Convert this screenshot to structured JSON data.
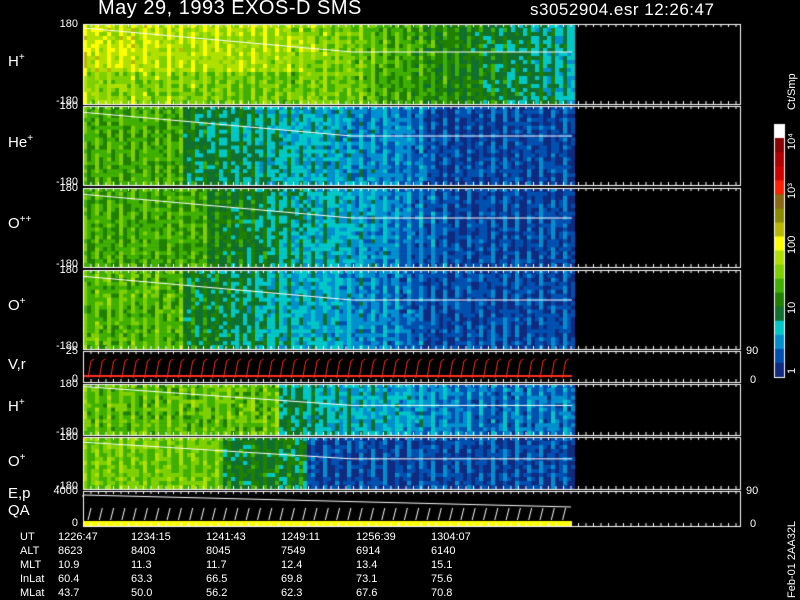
{
  "header": {
    "title": "May 29, 1993   EXOS-D SMS",
    "file_time": "s3052904.esr  12:26:47"
  },
  "panels": [
    {
      "id": "h-plus",
      "label": "H",
      "sup": "+",
      "ytop": "180",
      "ybot": "-180"
    },
    {
      "id": "he-plus",
      "label": "He",
      "sup": "+",
      "ytop": "180",
      "ybot": "-180"
    },
    {
      "id": "o-pp",
      "label": "O",
      "sup": "++",
      "ytop": "180",
      "ybot": "-180"
    },
    {
      "id": "o-plus",
      "label": "O",
      "sup": "+",
      "ytop": "180",
      "ybot": "-180"
    },
    {
      "id": "vr",
      "label": "V,r",
      "sup": "",
      "ytop": "25",
      "ybot": "0",
      "rtop": "90",
      "rbot": "0"
    },
    {
      "id": "h-plus-2",
      "label": "H",
      "sup": "+",
      "ytop": "180",
      "ybot": "-180"
    },
    {
      "id": "o-plus-2",
      "label": "O",
      "sup": "+",
      "ytop": "180",
      "ybot": "-180"
    },
    {
      "id": "ep-qa",
      "label": "E,p",
      "label2": "QA",
      "sup": "",
      "ytop": "4000",
      "ybot": "0",
      "rtop": "90",
      "rbot": "0"
    }
  ],
  "colorbar": {
    "unit": "Ct/Smp",
    "labels": [
      "10⁴",
      "10³",
      "100",
      "10",
      "1"
    ],
    "colors": [
      "#ffffff",
      "#8b0000",
      "#b00000",
      "#d00000",
      "#ff2000",
      "#8b6914",
      "#8b8b00",
      "#b8b800",
      "#ffff00",
      "#b0e000",
      "#7fd000",
      "#40b000",
      "#208000",
      "#107030",
      "#00c8c8",
      "#0090d0",
      "#0050b0",
      "#102a80"
    ]
  },
  "ephemeris": {
    "rows": [
      {
        "label": "UT",
        "values": [
          "1226:47",
          "1234:15",
          "1241:43",
          "1249:11",
          "1256:39",
          "1304:07"
        ]
      },
      {
        "label": "ALT",
        "values": [
          "8623",
          "8403",
          "8045",
          "7549",
          "6914",
          "6140"
        ]
      },
      {
        "label": "MLT",
        "values": [
          "10.9",
          "11.3",
          "11.7",
          "12.4",
          "13.4",
          "15.1"
        ]
      },
      {
        "label": "InLat",
        "values": [
          "60.4",
          "63.3",
          "66.5",
          "69.8",
          "73.1",
          "75.6"
        ]
      },
      {
        "label": "MLat",
        "values": [
          "43.7",
          "50.0",
          "56.2",
          "62.3",
          "67.6",
          "70.8"
        ]
      }
    ]
  },
  "footer_id": "Feb-01  2AA32L",
  "chart_data": {
    "type": "heatmap",
    "title": "May 29, 1993   EXOS-D SMS",
    "x_ticks": [
      "1226:47",
      "1234:15",
      "1241:43",
      "1249:11",
      "1256:39",
      "1304:07"
    ],
    "panels": [
      {
        "name": "H+",
        "ylim": [
          -180,
          180
        ]
      },
      {
        "name": "He+",
        "ylim": [
          -180,
          180
        ]
      },
      {
        "name": "O++",
        "ylim": [
          -180,
          180
        ]
      },
      {
        "name": "O+",
        "ylim": [
          -180,
          180
        ]
      },
      {
        "name": "V,r",
        "ylim": [
          0,
          25
        ],
        "y2lim": [
          0,
          90
        ]
      },
      {
        "name": "H+",
        "ylim": [
          -180,
          180
        ]
      },
      {
        "name": "O+",
        "ylim": [
          -180,
          180
        ]
      },
      {
        "name": "E,p / QA",
        "ylim": [
          0,
          4000
        ],
        "y2lim": [
          0,
          90
        ]
      }
    ],
    "colorbar": {
      "label": "Ct/Smp",
      "scale": "log",
      "range": [
        1,
        10000
      ]
    }
  }
}
